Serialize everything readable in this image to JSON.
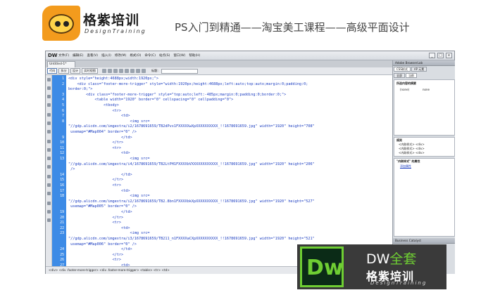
{
  "banner": {
    "logo_cn": "格紫培训",
    "logo_en": "DesignTraining",
    "title": "PS入门到精通——淘宝美工课程——高级平面设计"
  },
  "app": {
    "badge": "DW",
    "menu": [
      "文件(F)",
      "编辑(E)",
      "查看(V)",
      "插入(I)",
      "修改(M)",
      "格式(O)",
      "命令(C)",
      "站点(S)",
      "窗口(W)",
      "帮助(H)"
    ],
    "window_controls": [
      "_",
      "□",
      "x"
    ],
    "doc_tab": "Untitled-1*",
    "toolbar": {
      "buttons": [
        "代码",
        "拆分",
        "设计",
        "实时视图"
      ],
      "title_label": "标题:"
    },
    "status_path": "<div> <div .footer-more-trigger> <div .footer-more-trigger> <table> <tr> <td>",
    "code_lines": [
      {
        "n": "1",
        "text": "<div style=\"height:4688px;width:1920px;\">"
      },
      {
        "n": "2",
        "text": "    <div class=\"footer-more-trigger\" style=\"width:1920px;height:4688px;left:auto;top:auto;margin:0;padding:0;"
      },
      {
        "n": "",
        "text": "border:0;\">"
      },
      {
        "n": "3",
        "text": "        <div class=\"footer-more-trigger\" style=\"top:auto;left:-485px;margin:0;padding:0;border:0;\">"
      },
      {
        "n": "4",
        "text": "            <table width=\"1920\" border=\"0\" cellspacing=\"0\" cellpadding=\"0\">"
      },
      {
        "n": "5",
        "text": "                <tbody>"
      },
      {
        "n": "6",
        "text": "                    <tr>"
      },
      {
        "n": "7",
        "text": "                        <td>"
      },
      {
        "n": "8",
        "text": "                            <img src="
      },
      {
        "n": "",
        "text": "\"//gdp.alicdn.com/imgextra/i2/1678691659/TB2dPvx1FXXXXXwXpXXXXXXXXXX_!!1678691659.jpg\" width=\"1920\" height=\"708\""
      },
      {
        "n": "",
        "text": " usemap=\"#Map004\" border=\"0\" />"
      },
      {
        "n": "9",
        "text": "                        </td>"
      },
      {
        "n": "10",
        "text": "                    </tr>"
      },
      {
        "n": "11",
        "text": "                    <tr>"
      },
      {
        "n": "12",
        "text": "                        <td>"
      },
      {
        "n": "13",
        "text": "                            <img src="
      },
      {
        "n": "",
        "text": "\"//gdp.alicdn.com/imgextra/i4/1678691659/TB2LtPH1FXXXXbVXXXXXXXXXXXX_!!1678691659.jpg\" width=\"1920\" height=\"206\""
      },
      {
        "n": "",
        "text": " />"
      },
      {
        "n": "14",
        "text": "                        </td>"
      },
      {
        "n": "15",
        "text": "                    </tr>"
      },
      {
        "n": "16",
        "text": "                    <tr>"
      },
      {
        "n": "17",
        "text": "                        <td>"
      },
      {
        "n": "18",
        "text": "                            <img src="
      },
      {
        "n": "",
        "text": "\"//gdp.alicdn.com/imgextra/i2/1678691659/TB2.8bn1FXXXXbkXpXXXXXXXXXX_!!1678691659.jpg\" width=\"1920\" height=\"527\""
      },
      {
        "n": "",
        "text": " usemap=\"#Map005\" border=\"0\" />"
      },
      {
        "n": "19",
        "text": "                        </td>"
      },
      {
        "n": "20",
        "text": "                    </tr>"
      },
      {
        "n": "21",
        "text": "                    <tr>"
      },
      {
        "n": "22",
        "text": "                        <td>"
      },
      {
        "n": "23",
        "text": "                            <img src="
      },
      {
        "n": "",
        "text": "\"//gdp.alicdn.com/imgextra/i3/1678691659/TB211_n1FXXXXaCXpXXXXXXXXXX_!!1678691659.jpg\" width=\"1920\" height=\"521\""
      },
      {
        "n": "",
        "text": " usemap=\"#Map006\" border=\"0\" />"
      },
      {
        "n": "24",
        "text": "                        </td>"
      },
      {
        "n": "25",
        "text": "                    </tr>"
      },
      {
        "n": "26",
        "text": "                    <tr>"
      },
      {
        "n": "27",
        "text": "                        <td>"
      }
    ],
    "panels": {
      "browserlab": "Adobe BrowserLab",
      "css_tabs": [
        "CSS样式",
        "AP 元素"
      ],
      "sub_tabs": [
        "全部",
        "当前"
      ],
      "summary_title": "所选内容的摘要",
      "summary_cols": [
        "(none)",
        "none"
      ],
      "rules_title": "规则",
      "rules": [
        "<内联样式>    <div>",
        "<内联样式>    <div>",
        "<内联样式>    <div>"
      ],
      "props_title": "\"内联样式\" 的属性",
      "add_prop": "添加属性",
      "business": "Business Catalyst"
    }
  },
  "dw_badge": {
    "letters": "Dw",
    "suite_a": "DW",
    "suite_b": "全套",
    "brand_cn": "格紫培训",
    "brand_en": "DesignTraining"
  }
}
